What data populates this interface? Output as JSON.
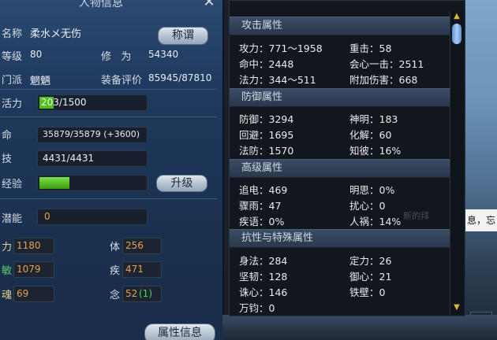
{
  "window": {
    "title": "人物信息",
    "close_icon": "close-icon"
  },
  "profile": {
    "name_label": "名称",
    "name_value": "柔水メ无伤",
    "title_button": "称谓",
    "level_label": "等级",
    "level_value": "80",
    "cultivation_label": "修   为",
    "cultivation_value": "54340",
    "sect_label": "门派",
    "sect_value": "魍魉",
    "gear_label": "装备评价",
    "gear_value": "85945/87810"
  },
  "bars": {
    "vitality_label": "活力",
    "vitality_value": "203/1500",
    "vitality_fraction": 0.135,
    "life_label": "命",
    "life_value": "35879/35879 (+3600)",
    "skill_label": "技",
    "skill_value": "4431/4431",
    "exp_label": "经验",
    "exp_fraction": 0.28,
    "upgrade_button": "升级",
    "potential_label": "潜能",
    "potential_value": "0"
  },
  "stats": {
    "strength_label": "力",
    "strength_value": "1180",
    "body_label": "体",
    "body_value": "256",
    "agility_label": "敏",
    "agility_value": "1079",
    "speed_label": "疾",
    "speed_value": "471",
    "soul_label": "魂",
    "soul_value": "69",
    "mind_label": "念",
    "mind_value": "52",
    "mind_bonus": "(1)"
  },
  "attr_button": "属性信息",
  "sections": {
    "attack": {
      "header": "攻击属性",
      "rows": [
        [
          "攻力：771～1958",
          "重击：58"
        ],
        [
          "命中：2448",
          "会心一击：2511"
        ],
        [
          "法力：344～511",
          "附加伤害：668"
        ]
      ]
    },
    "defense": {
      "header": "防御属性",
      "rows": [
        [
          "防御：3294",
          "神明：183"
        ],
        [
          "回避：1695",
          "化解：60"
        ],
        [
          "法防：1570",
          "知彼：16%"
        ]
      ]
    },
    "advanced": {
      "header": "高级属性",
      "rows": [
        [
          "追电：469",
          "明思：0%"
        ],
        [
          "骤雨：47",
          "扰心：0"
        ],
        [
          "疾语：0%",
          "人祸：14%"
        ]
      ]
    },
    "resist": {
      "header": "抗性与特殊属性",
      "rows": [
        [
          "身法：284",
          "定力：26"
        ],
        [
          "坚韧：128",
          "御心：21"
        ],
        [
          "诛心：146",
          "铁壁：0"
        ],
        [
          "万钧：0",
          ""
        ]
      ]
    }
  },
  "scene_text": "息，忘",
  "scene_text2": "新的拜",
  "colors": {
    "accent_gold": "#e3d28a",
    "stat_orange": "#e2a24d",
    "exp_green": "#4ec21b",
    "bonus_green": "#4fd15a"
  }
}
